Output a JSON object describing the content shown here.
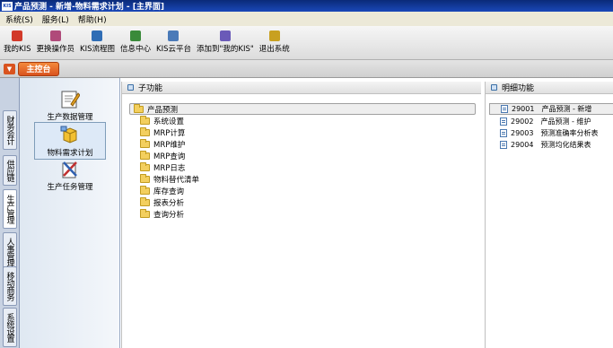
{
  "window": {
    "title": "产品预测 - 新增-物料需求计划 - [主界面]",
    "logo_text": "KIS"
  },
  "menubar": [
    "系统(S)",
    "服务(L)",
    "帮助(H)"
  ],
  "toolbar": [
    {
      "label": "我的KIS",
      "icon": "star-icon",
      "color": "#d23a2a"
    },
    {
      "label": "更换操作员",
      "icon": "users-icon",
      "color": "#b04a7a"
    },
    {
      "label": "KIS流程图",
      "icon": "flowchart-icon",
      "color": "#2f6db5"
    },
    {
      "label": "信息中心",
      "icon": "message-icon",
      "color": "#3a8a3a"
    },
    {
      "label": "KIS云平台",
      "icon": "cloud-icon",
      "color": "#4a7ab8"
    },
    {
      "label": "添加到\"我的KIS\"",
      "icon": "add-favorite-icon",
      "color": "#6a5ab8"
    },
    {
      "label": "退出系统",
      "icon": "exit-icon",
      "color": "#c8a020"
    }
  ],
  "tabs": {
    "main": "主控台"
  },
  "left_tabs": [
    "财务会计",
    "供应链",
    "生产管理",
    "人事管理",
    "移动商务",
    "系统设置"
  ],
  "nav_items": [
    {
      "label": "生产数据管理",
      "icon": "production-data-icon"
    },
    {
      "label": "物料需求计划",
      "icon": "mrp-icon"
    },
    {
      "label": "生产任务管理",
      "icon": "production-task-icon"
    }
  ],
  "sub_panel": {
    "header": "子功能",
    "items": [
      "产品预测",
      "系统设置",
      "MRP计算",
      "MRP维护",
      "MRP查询",
      "MRP日志",
      "物料替代清单",
      "库存查询",
      "报表分析",
      "查询分析"
    ]
  },
  "detail_panel": {
    "header": "明细功能",
    "items": [
      {
        "code": "29001",
        "name": "产品预测 - 新增"
      },
      {
        "code": "29002",
        "name": "产品预测 - 维护"
      },
      {
        "code": "29003",
        "name": "预测准确率分析表"
      },
      {
        "code": "29004",
        "name": "预测均化结果表"
      }
    ]
  }
}
